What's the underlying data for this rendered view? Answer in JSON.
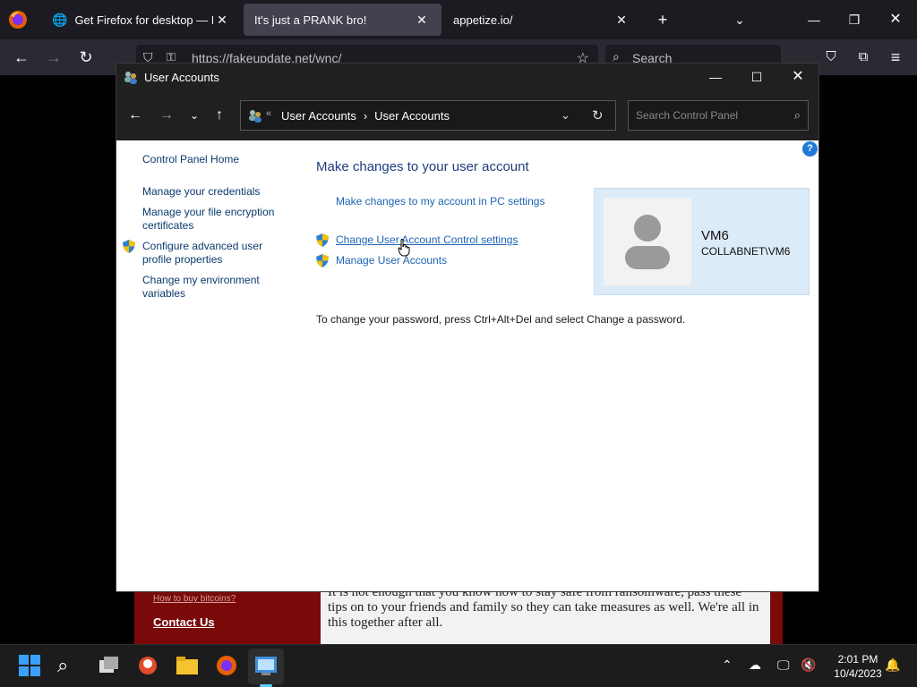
{
  "browser": {
    "tabs": [
      {
        "title": "Get Firefox for desktop — Mozi",
        "active": false
      },
      {
        "title": "It's just a PRANK bro!",
        "active": true
      },
      {
        "title": "appetize.io/",
        "active": false
      }
    ],
    "url": "https://fakeupdate.net/wnc/",
    "search_placeholder": "Search"
  },
  "background_page": {
    "link_bitcoins": "How to buy bitcoins?",
    "link_contact": "Contact Us",
    "body_text": "It is not enough that you know how to stay safe from ransomware, pass these tips on to your friends and family so they can take measures as well. We're all in this together after all."
  },
  "window": {
    "title": "User Accounts",
    "breadcrumb": [
      "User Accounts",
      "User Accounts"
    ],
    "search_placeholder": "Search Control Panel",
    "sidebar": [
      {
        "label": "Control Panel Home",
        "shield": false
      },
      {
        "label": "Manage your credentials",
        "shield": false
      },
      {
        "label": "Manage your file encryption certificates",
        "shield": false
      },
      {
        "label": "Configure advanced user profile properties",
        "shield": true
      },
      {
        "label": "Change my environment variables",
        "shield": false
      }
    ],
    "heading": "Make changes to your user account",
    "links": {
      "pc_settings": "Make changes to my account in PC settings",
      "uac": "Change User Account Control settings",
      "manage": "Manage User Accounts"
    },
    "password_note": "To change your password, press Ctrl+Alt+Del and select Change a password.",
    "account": {
      "name": "VM6",
      "domain": "COLLABNET\\VM6"
    }
  },
  "taskbar": {
    "time": "2:01 PM",
    "date": "10/4/2023"
  },
  "colors": {
    "link": "#1d63b1",
    "heading": "#1e3e7c",
    "account_panel": "#dcebf8"
  }
}
